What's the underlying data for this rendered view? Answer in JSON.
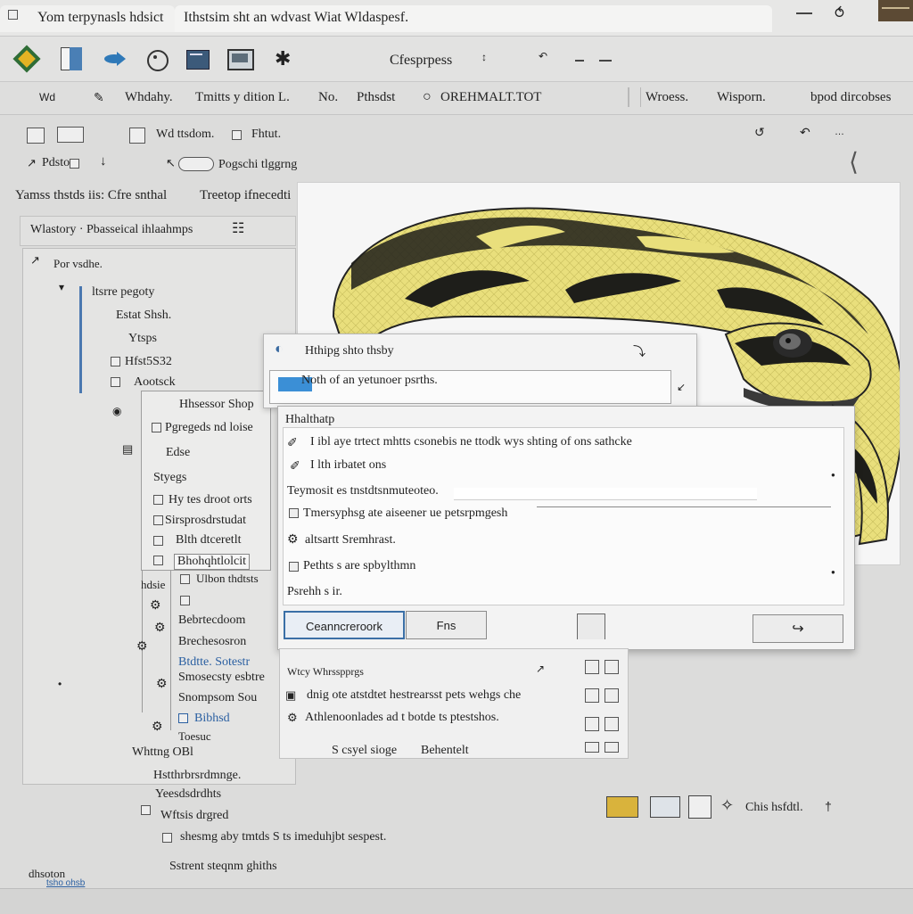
{
  "titlebar": {
    "title_left": "Yom terpynasls hdsict",
    "title_main": "Ithstsim sht an wdvast Wiat Wldaspesf.",
    "window_buttons": [
      "minimize-icon",
      "help-icon"
    ]
  },
  "ribbon": {
    "center_label": "Cfesprpess",
    "icons": [
      "app-logo-icon",
      "document-icon",
      "fish-icon",
      "palette-icon",
      "book-icon",
      "image-icon",
      "star-icon"
    ]
  },
  "menurow": {
    "items": [
      "Wd",
      "Whdahy.",
      "Tmitts y dition L.",
      "No.",
      "Pthsdst",
      "OREHMALT.TOT",
      "Wroess.",
      "Wisporn.",
      "bpod dircobses"
    ]
  },
  "left": {
    "toolrow1": [
      "Wd ttsdom.",
      "Fhtut."
    ],
    "toolrow2": [
      "Pdstoe",
      "Pogschi tlggrng"
    ],
    "heading": "Yamss thstds iis: Cfre snthal",
    "heading_right": "Treetop ifnecedti",
    "section": "Wlastory · Pbasseical ihlaahmps",
    "tree_header": "Por  vsdhe.",
    "tree_items": [
      "ltsrre pegoty",
      "Estat Shsh.",
      "Ytsps",
      "Hfst5S32",
      "Aootsck",
      "Hhsessor Shop",
      "Pgregeds nd loise",
      "Edse",
      "Styegs",
      "Hy tes droot orts",
      "Sirsprosdrstudat",
      "Blth dtceretlt",
      "Bhohqhtlolcit",
      "Ulbon thdtsts",
      "Bebrtecdoom",
      "Brechesosron",
      "Btdtte. Sotestr",
      "Smosecsty esbtre",
      "Snompsom Sou",
      "Bibhsd",
      "Toesuc",
      "hdsie"
    ],
    "outside_items": [
      "Whttng OBl",
      "Hstthrbrsrdmnge.",
      "Yeesdsdrdhts",
      "Wftsis drgred",
      "shesmg aby tmtds S ts imeduhjbt sespest.",
      "Sstrent steqnm ghiths",
      "dhsoton"
    ]
  },
  "dialog_top": {
    "title": "Hthipg shto thsby",
    "field": "Noth of an yetunoer psrths."
  },
  "dialog": {
    "heading": "Hhalthatp",
    "rows": [
      "I ibl aye trtect mhtts csonebis ne ttodk wys shting of ons sathcke",
      "I lth irbatet ons",
      "Teymosit es tnstdtsnmuteoteo.",
      "Tmersyphsg ate aiseener ue petsrpmgesh",
      "altsartt Sremhrast.",
      "Pethts s are spbylthmn",
      "Psrehh s ir."
    ],
    "btn_primary": "Ceanncreroork",
    "btn_secondary": "Fns"
  },
  "popup": {
    "header": "Wtcy Whrsspprgs",
    "line1": "dnig ote atstdtet hestrearsst pets wehgs che",
    "line2": "Athlenoonlades ad t botde ts ptestshos.",
    "footer_left": "S csyel sioge",
    "footer_right": "Behentelt"
  },
  "lower_right_label": "Chis hsfdtl.",
  "statusbar_link": "tsho ohsb"
}
